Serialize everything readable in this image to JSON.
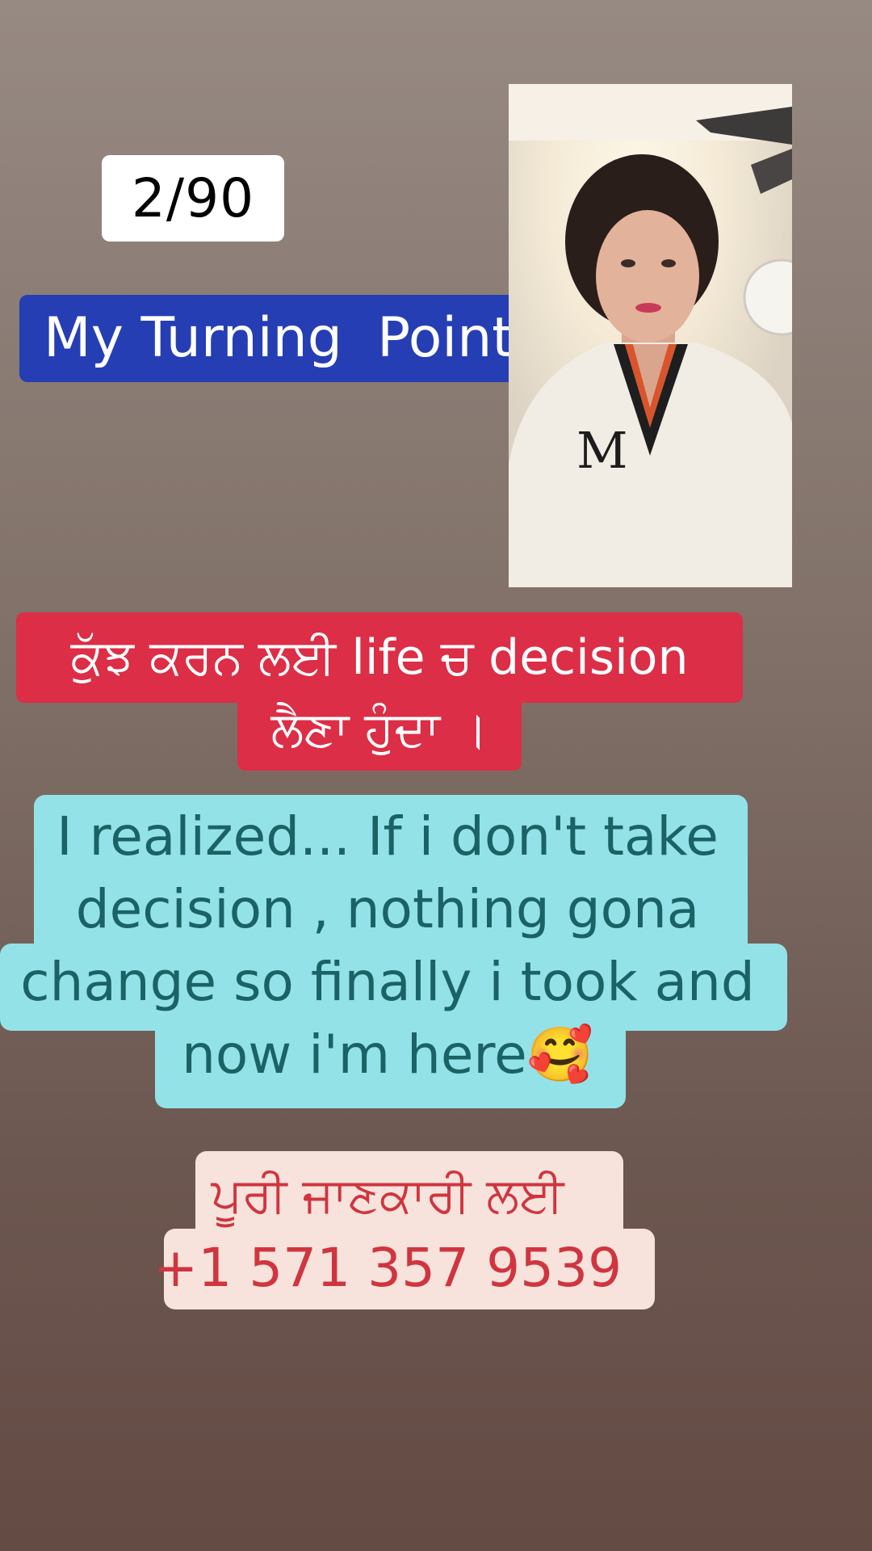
{
  "story": {
    "counter": "2/90",
    "title": "My Turning  Point",
    "punjabi_caption": {
      "line1": "ਕੁੱਝ ਕਰਨ ਲਈ life ਚ decision",
      "line2": "ਲੈਣਾ ਹੁੰਦਾ ।"
    },
    "message": {
      "line1": "I realized... If i don't take",
      "line2": "decision , nothing gona",
      "line3": "change so finally i took and",
      "line4": "now i'm here🥰"
    },
    "contact": {
      "label": "ਪੂਰੀ ਜਾਣਕਾਰੀ ਲਈ",
      "phone": "+1 571 357 9539"
    }
  },
  "colors": {
    "title_bg": "#263eb3",
    "punjabi_bg": "#dc2e46",
    "message_bg": "#93e2e8",
    "message_text": "#1b6266",
    "contact_bg": "#f7e3dc",
    "contact_text": "#d0353f"
  }
}
